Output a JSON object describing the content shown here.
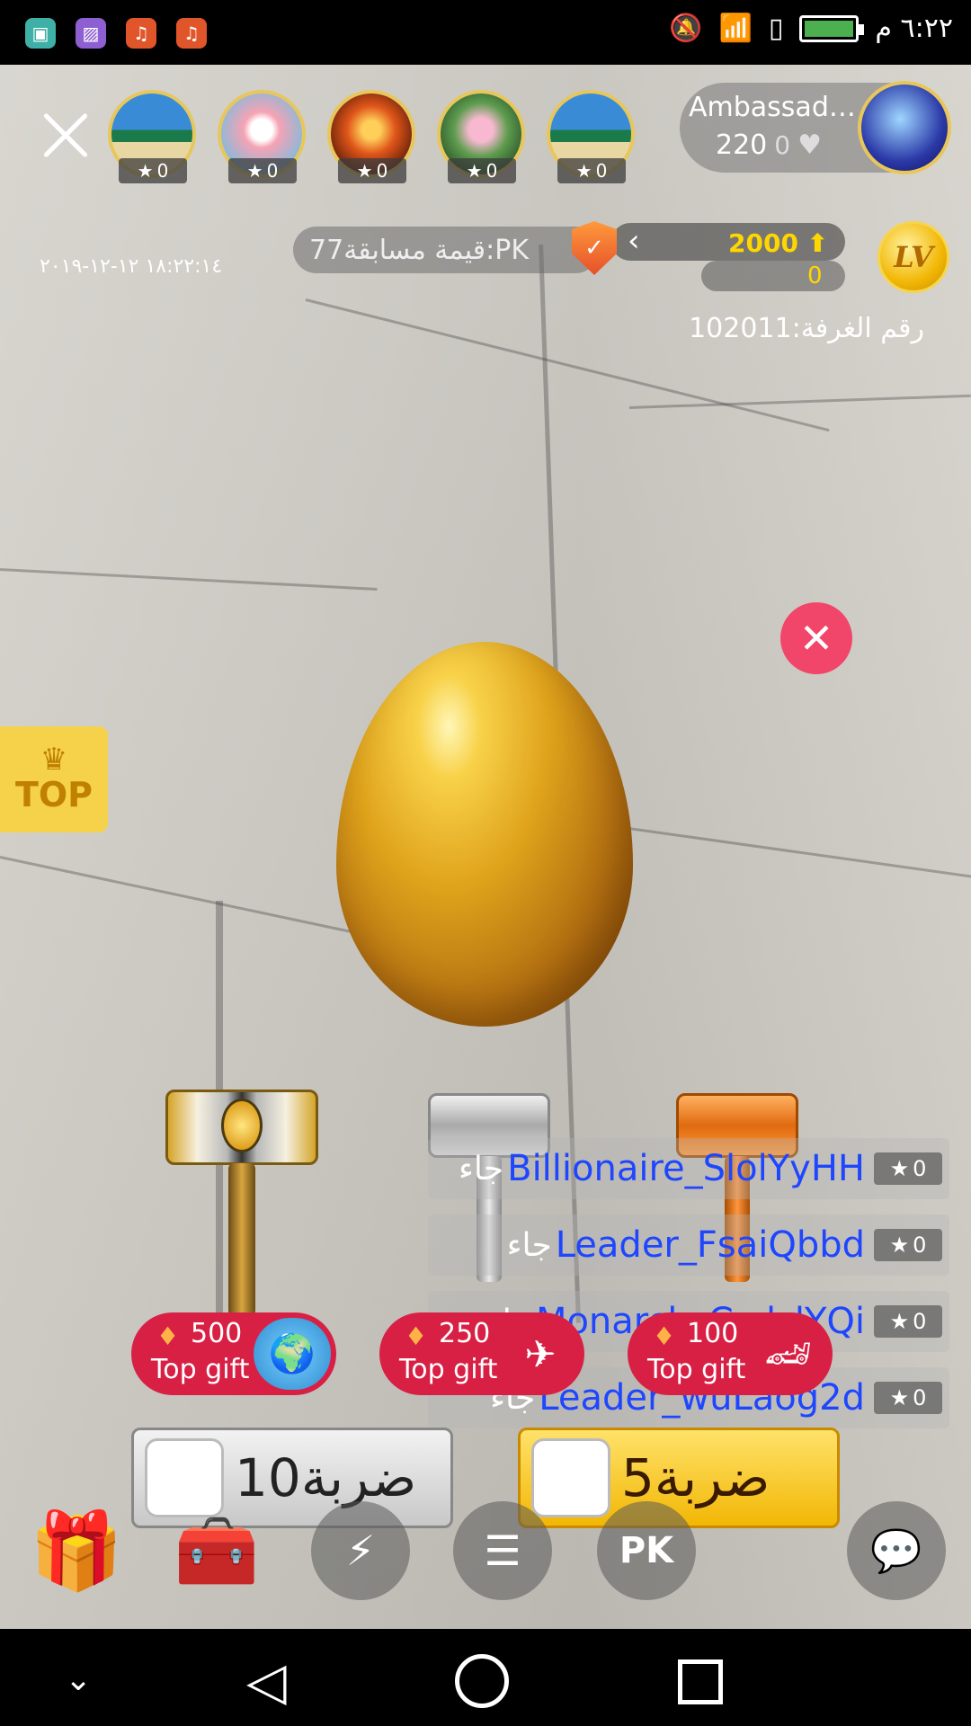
{
  "status_bar": {
    "time": "٦:٢٢ م",
    "app_icons": [
      "android-icon",
      "gallery-icon",
      "music-icon",
      "music-icon"
    ]
  },
  "audience": {
    "avatars": [
      {
        "stars": "0"
      },
      {
        "stars": "0"
      },
      {
        "stars": "0"
      },
      {
        "stars": "0"
      },
      {
        "stars": "0"
      }
    ]
  },
  "host": {
    "name": "Ambassad…",
    "count": "220",
    "hearts": "0"
  },
  "level": {
    "coins": "2000",
    "sub_coins": "0",
    "badge": "LV"
  },
  "pk": {
    "label": "قيمة مسابقة77:PK"
  },
  "datetime": "١٨:٢٢:١٤ ١٢-١٢-٢٠١٩",
  "room": {
    "number_label": "رقم الغرفة:102011"
  },
  "top_button": {
    "label": "TOP"
  },
  "chat": {
    "rows": [
      {
        "name": "Billionaire_SlolYyHH",
        "verb": "جاء",
        "stars": "0"
      },
      {
        "name": "Leader_FsaiQbbd",
        "verb": "جاء",
        "stars": "0"
      },
      {
        "name": "Monarch_CcdslYQi",
        "verb": "جاء",
        "stars": "0"
      },
      {
        "name": "Leader_wuLaog2d",
        "verb": "جاء",
        "stars": "0"
      }
    ]
  },
  "gifts": [
    {
      "amount": "500",
      "label": "Top gift"
    },
    {
      "amount": "250",
      "label": "Top gift"
    },
    {
      "amount": "100",
      "label": "Top gift"
    }
  ],
  "strikes": {
    "ten": "10ضربة",
    "five": "5ضربة"
  },
  "colors": {
    "accent_red": "#d82045",
    "gold": "#f2b705",
    "chat_name": "#1f46ff"
  }
}
